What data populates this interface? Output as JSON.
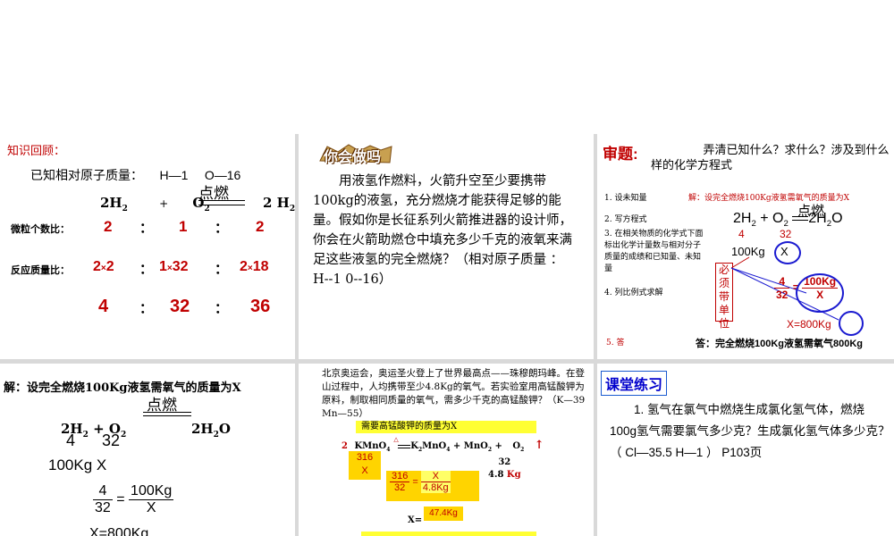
{
  "p1": {
    "title": "知识回顾：",
    "known": "已知相对原子质量：",
    "h": "H—1",
    "o": "O—16",
    "eq_left": "2H",
    "eq_plus": "+",
    "eq_o2": "O",
    "condition": "点燃",
    "eq_right": "2 H",
    "eq_right_o": "O",
    "ratio_label": "微粒个数比：",
    "ratio": [
      "2",
      "1",
      "2"
    ],
    "mass_label": "反应质量比：",
    "mass": [
      "2",
      "2",
      "1",
      "32",
      "2",
      "18"
    ],
    "mass_result": [
      "4",
      "32",
      "36"
    ],
    "colon": "：",
    "times": "×"
  },
  "p2": {
    "badge": "你会做吗",
    "text": "用液氢作燃料，火箭升空至少要携带100kg的液氢，充分燃烧才能获得足够的能量。假如你是长征系列火箭推进器的设计师，你会在火箭助燃仓中填充多少千克的液氧来满足这些液氢的完全燃烧？（相对原子质量 ：  H--1   0--16）"
  },
  "p3": {
    "title": "审题:",
    "question": "弄清已知什么？求什么？涉及到什么样的化学方程式",
    "step1": "1. 设未知量",
    "solve": "解：设完全燃烧100Kg液氢需氧气的质量为X",
    "step2": "2. 写方程式",
    "eq_2h2": "2H",
    "eq_o2": "+ O",
    "eq_2h2o": "2H",
    "eq_o": "O",
    "condition": "点燃",
    "step3": "3. 在相关物质的化学式下面标出化学计量数与相对分子质量的成绩和已知量、未知量",
    "n4": "4",
    "n32": "32",
    "v100": "100Kg",
    "vx": "X",
    "must": "必须带单位",
    "step4": "4. 列比例式求解",
    "frac_l_num": "4",
    "frac_l_den": "32",
    "frac_r_num": "100Kg",
    "frac_r_den": "X",
    "eq_sign": "=",
    "result": "X=800Kg",
    "step5": "5. 答",
    "answer": "答：完全燃烧100Kg液氢需氧气800Kg"
  },
  "p4": {
    "solve": "解：设完全燃烧100Kg液氢需氧气的质量为X",
    "condition": "点燃",
    "eq_left": "2H",
    "eq_plus": "+ O",
    "eq_right": "2H",
    "eq_right_o": "O",
    "n4": "4",
    "n32": "32",
    "v100": "100Kg",
    "vx": "X",
    "frac_l_num": "4",
    "frac_l_den": "32",
    "frac_r_num": "100Kg",
    "frac_r_den": "X",
    "eq_sign": "=",
    "result": "X=800Kg"
  },
  "p5": {
    "text": "北京奥运会，奥运圣火登上了世界最高点——珠穆朗玛峰。在登山过程中，人均携带至少4.8Kg的氧气。若实验室用高锰酸钾为原料，制取相同质量的氧气，需多少千克的高锰酸钾？（K—39  Mn—55）",
    "solve": "需要高锰酸钾的质量为X",
    "coef": "2",
    "kmno4": "KMnO",
    "arrow_top": "△",
    "k2mno4": "K",
    "plus": "+ MnO",
    "plus2": "+",
    "o2": "O",
    "up": "↑",
    "n316": "316",
    "vx": "X",
    "n32": "32",
    "v48": "4.8",
    "kg": "Kg",
    "frac_l_num": "316",
    "frac_l_den": "32",
    "frac_r_num": "X",
    "frac_r_den": "4.8Kg",
    "eq_sign": "=",
    "result_label": "X=",
    "result": "47.4Kg"
  },
  "p6": {
    "title": "课堂练习",
    "text": "1. 氢气在氯气中燃烧生成氯化氢气体，燃烧100g氢气需要氯气多少克？生成氯化氢气体多少克？（ Cl—35.5   H—1 ） P103页"
  }
}
